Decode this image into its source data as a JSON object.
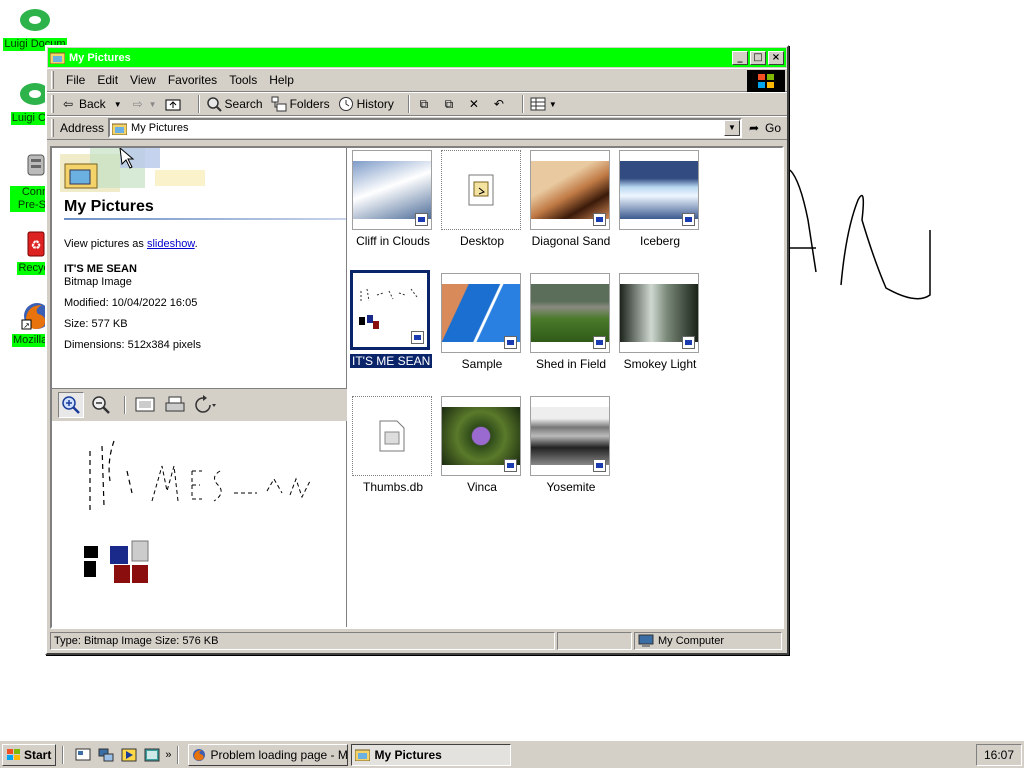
{
  "desktop": {
    "icons": [
      {
        "label": "Luigi Docum",
        "icon": "cloud-icon"
      },
      {
        "label": "Luigi Con",
        "icon": "cloud-icon"
      },
      {
        "label": "Conn Pre-Se",
        "icon": "network-icon"
      },
      {
        "label": "Recycl",
        "icon": "recycle-bin-icon"
      },
      {
        "label": "Mozilla F",
        "icon": "firefox-icon"
      }
    ],
    "label_color": "#00ff00"
  },
  "window": {
    "title": "My Pictures",
    "title_bar_color": "#00ff00",
    "controls": {
      "minimize": "_",
      "maximize": "□",
      "close": "×"
    }
  },
  "menu": {
    "items": [
      {
        "label": "File",
        "key": "F"
      },
      {
        "label": "Edit",
        "key": "E"
      },
      {
        "label": "View",
        "key": "V"
      },
      {
        "label": "Favorites",
        "key": "a"
      },
      {
        "label": "Tools",
        "key": "T"
      },
      {
        "label": "Help",
        "key": "H"
      }
    ]
  },
  "toolbar": {
    "back_label": "Back",
    "search_label": "Search",
    "folders_label": "Folders",
    "history_label": "History"
  },
  "address": {
    "label": "Address",
    "value": "My Pictures",
    "go_label": "Go"
  },
  "left_pane": {
    "title": "My Pictures",
    "view_prefix": "View pictures as ",
    "view_link": "slideshow",
    "view_suffix": ".",
    "file_name": "IT'S ME SEAN",
    "file_type": "Bitmap Image",
    "modified": "Modified: 10/04/2022 16:05",
    "size": "Size: 577 KB",
    "dimensions": "Dimensions: 512x384 pixels"
  },
  "thumbnails": [
    {
      "name": "Cliff in Clouds",
      "kind": "photo"
    },
    {
      "name": "Desktop",
      "kind": "shortcut"
    },
    {
      "name": "Diagonal Sand",
      "kind": "photo"
    },
    {
      "name": "Iceberg",
      "kind": "photo"
    },
    {
      "name": "IT'S ME SEAN",
      "kind": "bitmap",
      "selected": true
    },
    {
      "name": "Sample",
      "kind": "photo"
    },
    {
      "name": "Shed in Field",
      "kind": "photo"
    },
    {
      "name": "Smokey Light",
      "kind": "photo"
    },
    {
      "name": "Thumbs.db",
      "kind": "file"
    },
    {
      "name": "Vinca",
      "kind": "photo"
    },
    {
      "name": "Yosemite",
      "kind": "photo"
    }
  ],
  "status": {
    "info": "Type: Bitmap Image Size: 576 KB",
    "zone": "My Computer"
  },
  "taskbar": {
    "start_label": "Start",
    "tasks": [
      {
        "label": "Problem loading page - Mo...",
        "active": false
      },
      {
        "label": "My Pictures",
        "active": true
      }
    ],
    "clock": "16:07"
  }
}
